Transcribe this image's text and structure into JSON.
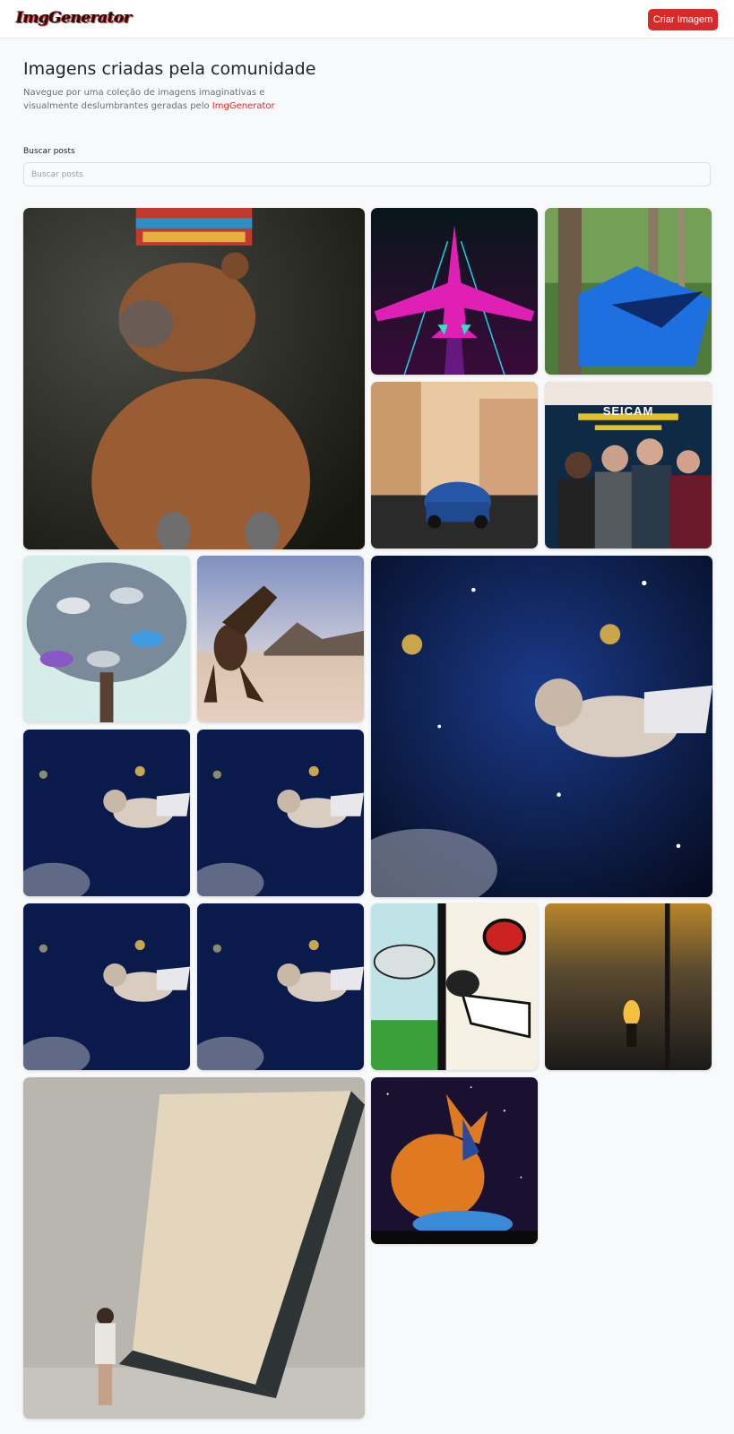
{
  "header": {
    "logo_text": "ImgGenerator",
    "create_label": "Criar Imagem"
  },
  "hero": {
    "title": "Imagens criadas pela comunidade",
    "description": "Navegue por uma coleção de imagens imaginativas e visualmente deslumbrantes geradas pelo",
    "brand": "ImgGenerator"
  },
  "search": {
    "label": "Buscar posts",
    "placeholder": "Buscar posts",
    "value": ""
  },
  "colors": {
    "accent": "#d92a2a",
    "background": "#f8f9fb"
  },
  "gallery": {
    "posts": [
      {
        "subject": "capybara-crown"
      },
      {
        "subject": "neon-jet"
      },
      {
        "subject": "blue-hammock"
      },
      {
        "subject": "blue-beetle-car"
      },
      {
        "subject": "movie-poster",
        "poster_text": "SEICAM"
      },
      {
        "subject": "sneaker-tree"
      },
      {
        "subject": "dinosaur-desert"
      },
      {
        "subject": "space-dog-large"
      },
      {
        "subject": "space-dog"
      },
      {
        "subject": "space-dog"
      },
      {
        "subject": "space-dog"
      },
      {
        "subject": "space-dog"
      },
      {
        "subject": "cartoon-mosquito"
      },
      {
        "subject": "burning-figure"
      },
      {
        "subject": "giant-book"
      },
      {
        "subject": "space-fox"
      }
    ]
  }
}
